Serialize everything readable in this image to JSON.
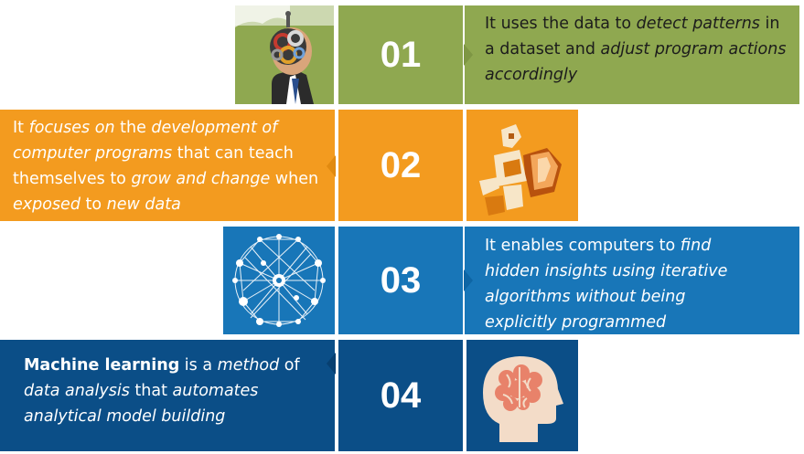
{
  "colors": {
    "green": "#8fa850",
    "green_dark": "#7e9644",
    "orange": "#f39b1f",
    "orange_dark": "#e18a10",
    "blue": "#1876b8",
    "blue_dark": "#0e65a4",
    "navy": "#0b4e87",
    "navy_dark": "#073f70"
  },
  "rows": [
    {
      "number": "01",
      "icon": "head-gears-icon",
      "text_parts": [
        {
          "t": "It uses the data to "
        },
        {
          "t": "detect patterns",
          "i": true
        },
        {
          "t": " in a dataset and "
        },
        {
          "t": "adjust program actions accordingly",
          "i": true
        }
      ]
    },
    {
      "number": "02",
      "icon": "robot-reading-book-icon",
      "text_parts": [
        {
          "t": "It "
        },
        {
          "t": "focuses on",
          "i": true
        },
        {
          "t": " the "
        },
        {
          "t": "development of computer programs",
          "i": true
        },
        {
          "t": " that can teach themselves to "
        },
        {
          "t": "grow and change",
          "i": true
        },
        {
          "t": " when "
        },
        {
          "t": "exposed",
          "i": true
        },
        {
          "t": " to "
        },
        {
          "t": "new data",
          "i": true
        }
      ]
    },
    {
      "number": "03",
      "icon": "network-globe-icon",
      "text_parts": [
        {
          "t": "It enables computers to "
        },
        {
          "t": "find hidden",
          "i": true
        },
        {
          "t": " insights using iterative algorithms",
          "i": true
        },
        {
          "t": " without being",
          "i": true
        },
        {
          "t": " explicitly programmed",
          "i": true
        }
      ]
    },
    {
      "number": "04",
      "icon": "brain-head-icon",
      "text_parts": [
        {
          "t": "Machine learning",
          "b": true
        },
        {
          "t": " is a "
        },
        {
          "t": "method",
          "i": true
        },
        {
          "t": " of "
        },
        {
          "t": "data analysis",
          "i": true
        },
        {
          "t": " that "
        },
        {
          "t": "automates analytical model building",
          "i": true
        }
      ]
    }
  ]
}
